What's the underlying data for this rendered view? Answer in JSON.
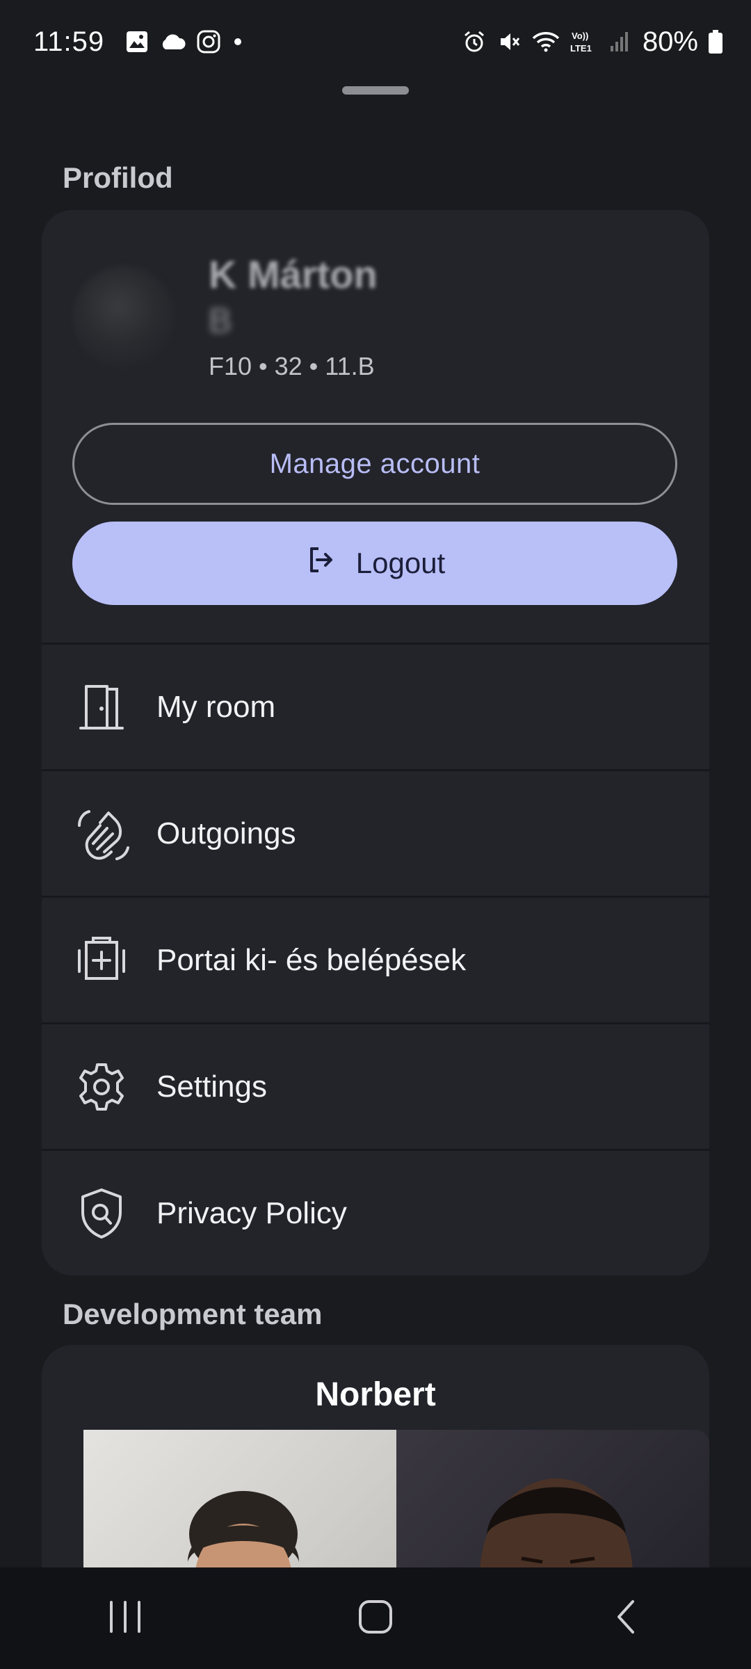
{
  "status_bar": {
    "time": "11:59",
    "battery": "80%"
  },
  "profile_section": {
    "title": "Profilod",
    "name_line1": "K Márton",
    "name_line2": "B",
    "meta": "F10 • 32 • 11.B",
    "manage_account_label": "Manage account",
    "logout_label": "Logout"
  },
  "menu": {
    "items": [
      {
        "label": "My room",
        "icon": "door-icon"
      },
      {
        "label": "Outgoings",
        "icon": "waving-hand-icon"
      },
      {
        "label": "Portai ki- és belépések",
        "icon": "entry-exit-icon"
      },
      {
        "label": "Settings",
        "icon": "gear-icon"
      },
      {
        "label": "Privacy Policy",
        "icon": "shield-search-icon"
      }
    ]
  },
  "team_section": {
    "title": "Development team",
    "member_name": "Norbert"
  },
  "colors": {
    "background": "#1a1b1f",
    "card": "#22242a",
    "accent": "#b9c0f8",
    "accent_text": "#b9bdf5"
  }
}
